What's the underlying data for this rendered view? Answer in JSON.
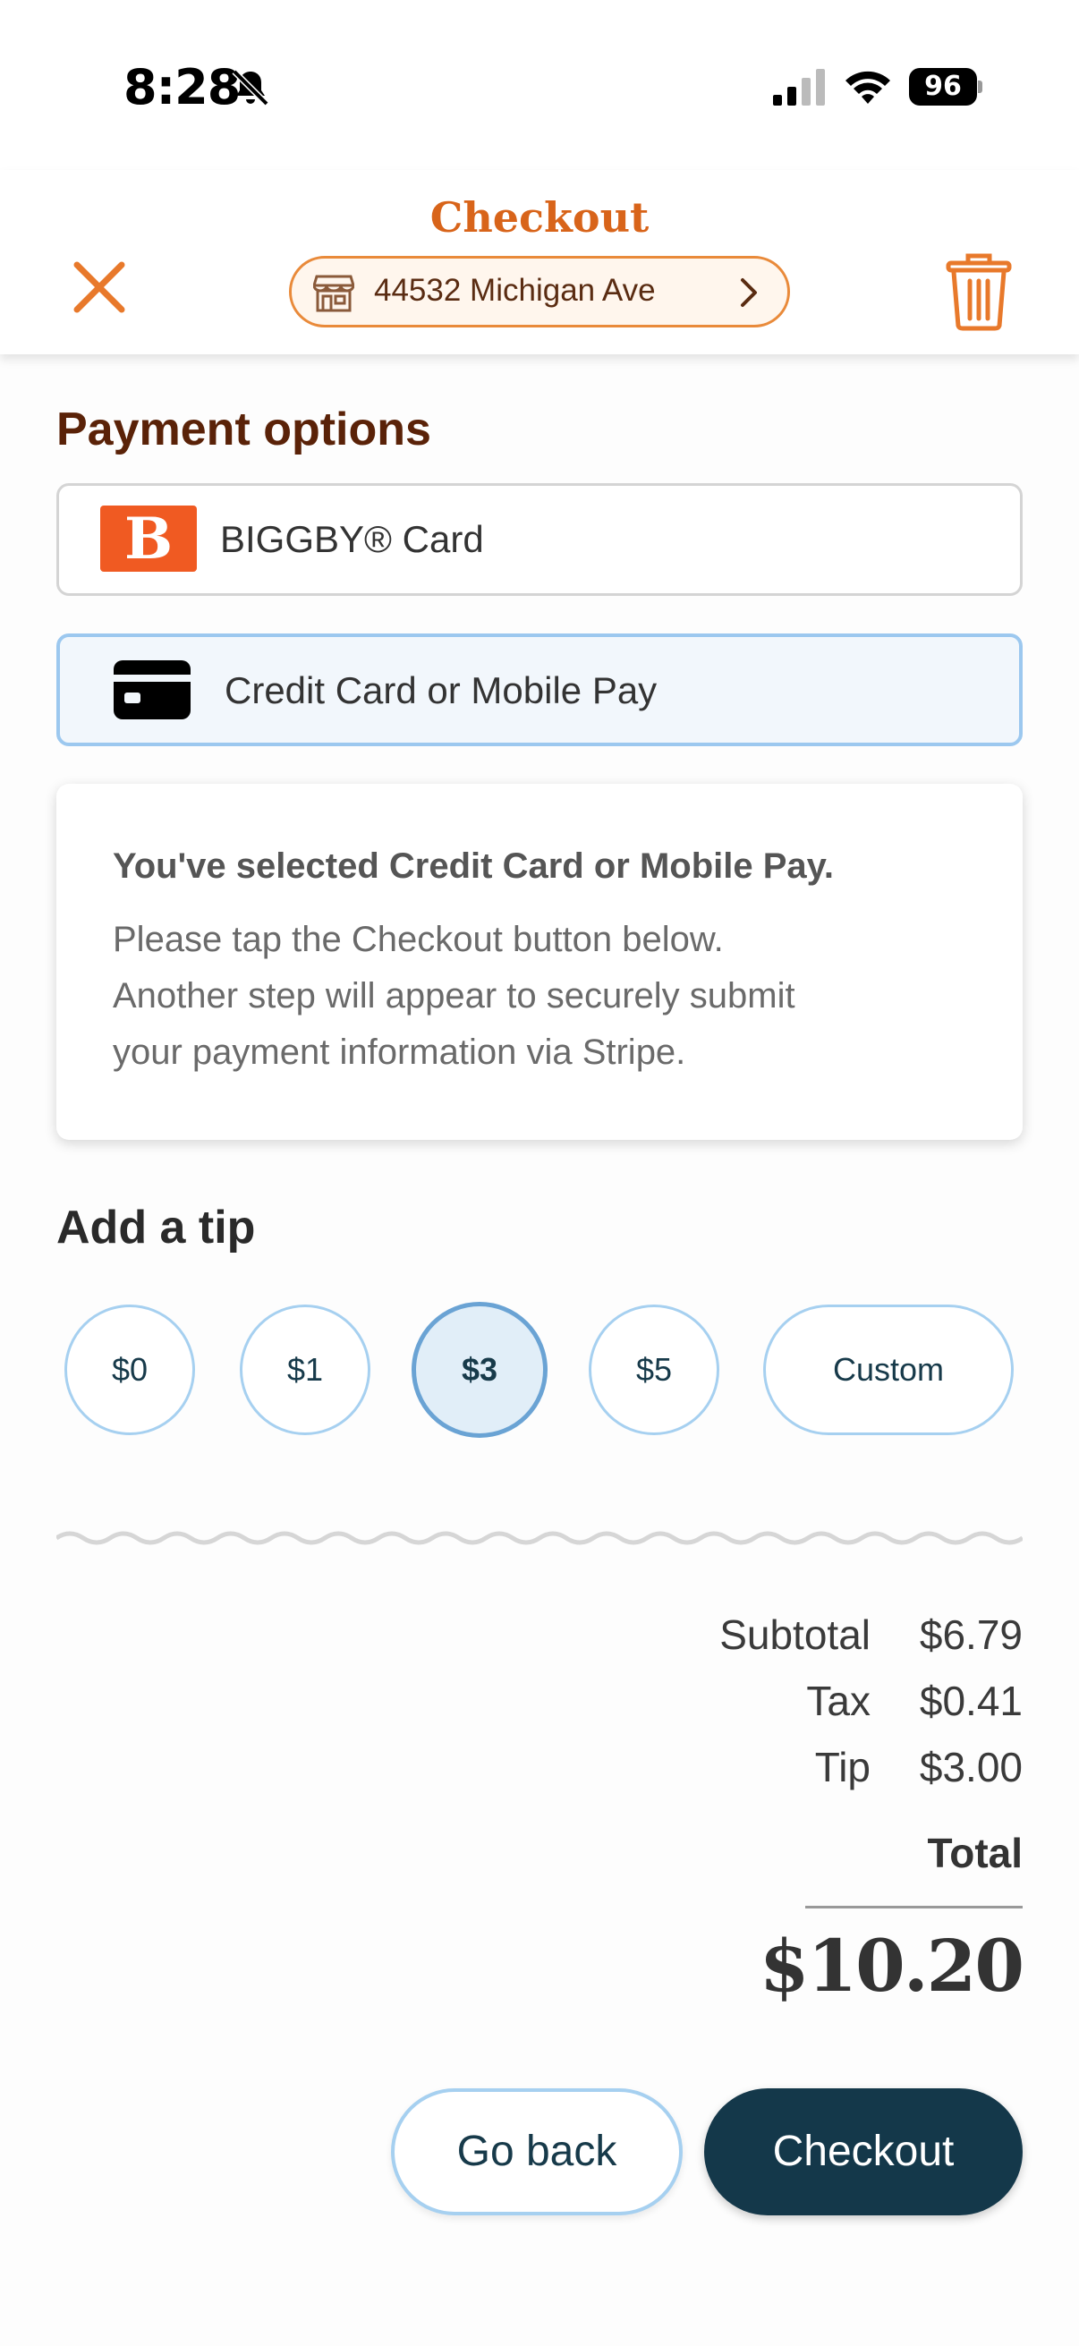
{
  "status_bar": {
    "time": "8:28",
    "battery": "96"
  },
  "header": {
    "title": "Checkout",
    "location": "44532 Michigan Ave"
  },
  "payment": {
    "title": "Payment options",
    "options": [
      {
        "label": "BIGGBY® Card",
        "logo_letter": "B"
      },
      {
        "label": "Credit Card or Mobile Pay",
        "selected": true
      }
    ]
  },
  "info": {
    "heading": "You've selected Credit Card or Mobile Pay.",
    "lines": [
      "Please tap the Checkout button below.",
      "Another step will appear to securely submit",
      "your payment information via Stripe."
    ]
  },
  "tip": {
    "title": "Add a tip",
    "options": [
      "$0",
      "$1",
      "$3",
      "$5",
      "Custom"
    ],
    "selected": "$3"
  },
  "totals": {
    "subtotal_label": "Subtotal",
    "subtotal": "$6.79",
    "tax_label": "Tax",
    "tax": "$0.41",
    "tip_label": "Tip",
    "tip": "$3.00",
    "total_label": "Total",
    "total": "$10.20"
  },
  "actions": {
    "back": "Go back",
    "checkout": "Checkout"
  },
  "colors": {
    "brand_orange": "#d8641a",
    "selected_blue": "#9cc8ef",
    "navy": "#14384a"
  }
}
